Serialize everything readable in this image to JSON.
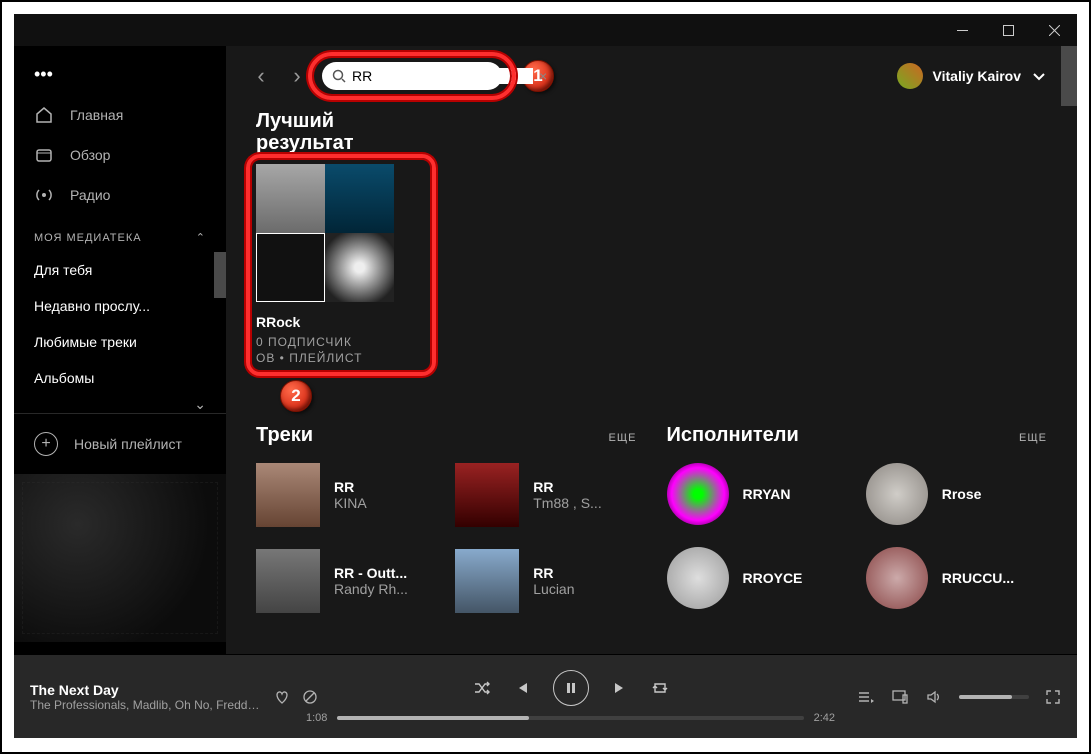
{
  "window": {
    "user_name": "Vitaliy Kairov"
  },
  "nav": {
    "home": "Главная",
    "browse": "Обзор",
    "radio": "Радио"
  },
  "library": {
    "header": "МОЯ МЕДИАТЕКА",
    "items": [
      "Для тебя",
      "Недавно прослу...",
      "Любимые треки",
      "Альбомы"
    ],
    "new_playlist": "Новый плейлист"
  },
  "search": {
    "query": "RR"
  },
  "best": {
    "heading_l1": "Лучший",
    "heading_l2": "результат",
    "name": "RRock",
    "sub_l1": "0 ПОДПИСЧИК",
    "sub_l2": "ОВ • ПЛЕЙЛИСТ"
  },
  "callouts": {
    "c1": "1",
    "c2": "2"
  },
  "tracks": {
    "heading": "Треки",
    "more": "ЕЩЕ",
    "items": [
      {
        "title": "RR",
        "artist": "KINA"
      },
      {
        "title": "RR",
        "artist": "Tm88 , S..."
      },
      {
        "title": "RR - Outt...",
        "artist": "Randy Rh..."
      },
      {
        "title": "RR",
        "artist": "Lucian"
      }
    ]
  },
  "artists": {
    "heading": "Исполнители",
    "more": "ЕЩЕ",
    "items": [
      {
        "name": "RRYAN"
      },
      {
        "name": "Rrose"
      },
      {
        "name": "RROYCE"
      },
      {
        "name": "RRUCCU..."
      }
    ]
  },
  "player": {
    "title": "The Next Day",
    "artists": "The Professionals, Madlib, Oh No, Freddie Gibbs",
    "elapsed": "1:08",
    "total": "2:42"
  }
}
